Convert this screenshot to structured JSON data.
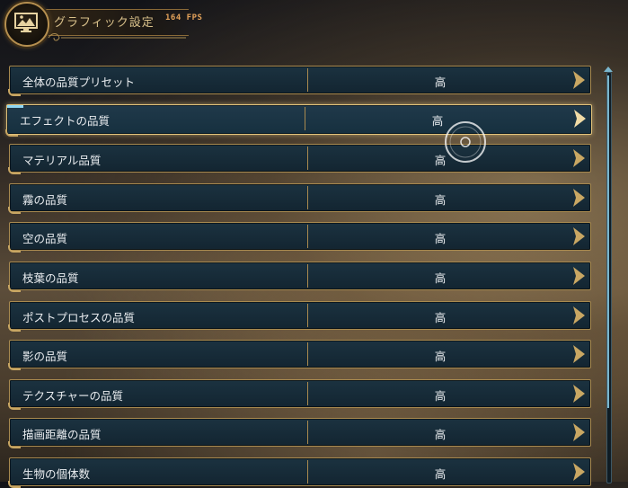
{
  "header": {
    "title": "グラフィック設定",
    "fps": "164 FPS",
    "icon": "monitor-landscape-icon"
  },
  "settings": [
    {
      "label": "全体の品質プリセット",
      "value": "高"
    },
    {
      "label": "エフェクトの品質",
      "value": "高",
      "selected": true
    },
    {
      "label": "マテリアル品質",
      "value": "高"
    },
    {
      "label": "霧の品質",
      "value": "高"
    },
    {
      "label": "空の品質",
      "value": "高"
    },
    {
      "label": "枝葉の品質",
      "value": "高"
    },
    {
      "label": "ポストプロセスの品質",
      "value": "高"
    },
    {
      "label": "影の品質",
      "value": "高"
    },
    {
      "label": "テクスチャーの品質",
      "value": "高"
    },
    {
      "label": "描画距離の品質",
      "value": "高"
    },
    {
      "label": "生物の個体数",
      "value": "高"
    }
  ],
  "colors": {
    "gold": "#a98a4f",
    "row_bg": "#1b3240",
    "text": "#e9ecef",
    "fps": "#e3a25a",
    "accent": "#8fd6f2"
  }
}
